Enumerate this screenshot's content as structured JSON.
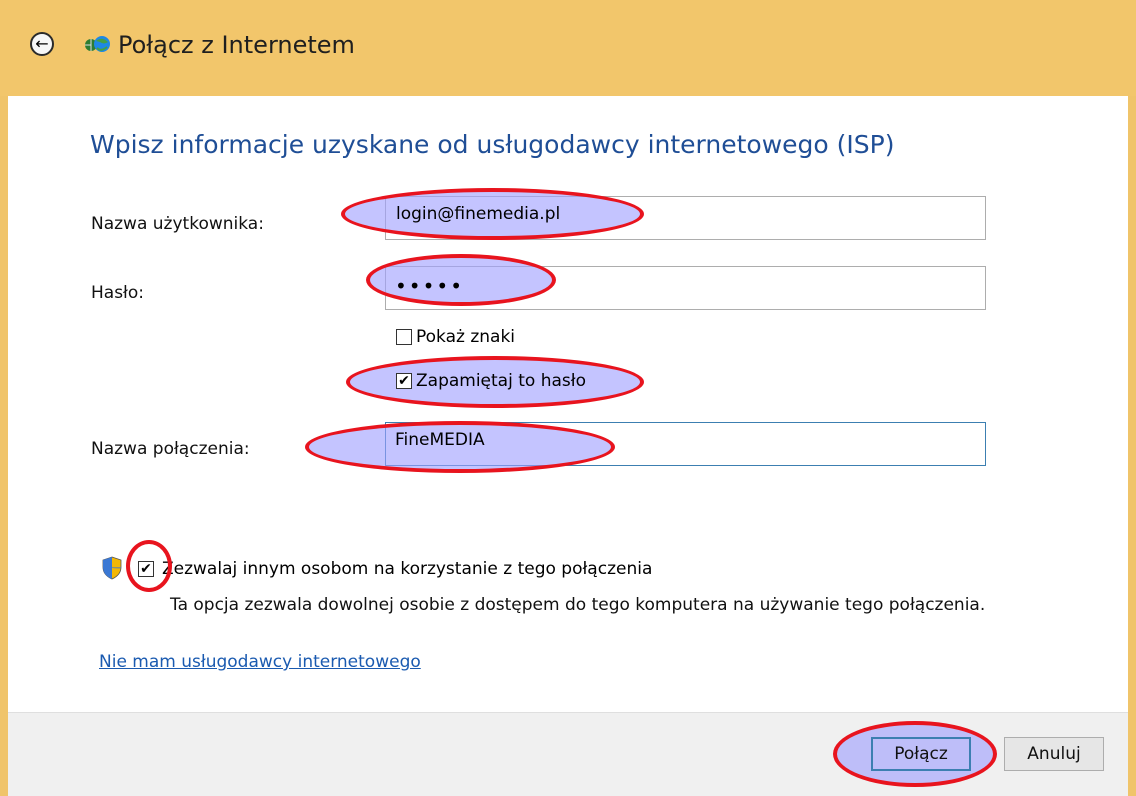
{
  "window": {
    "title": "Połącz z Internetem"
  },
  "main": {
    "heading": "Wpisz informacje uzyskane od usługodawcy internetowego (ISP)",
    "username_label": "Nazwa użytkownika:",
    "username_value": "login@finemedia.pl",
    "password_label": "Hasło:",
    "password_value": "•••••",
    "show_chars_label": "Pokaż znaki",
    "show_chars_checked": false,
    "remember_label": "Zapamiętaj to hasło",
    "remember_checked": true,
    "connection_label": "Nazwa połączenia:",
    "connection_value": "FineMEDIA",
    "allow_others_label": "Zezwalaj innym osobom na korzystanie z tego połączenia",
    "allow_others_checked": true,
    "allow_others_desc": "Ta opcja zezwala dowolnej osobie z dostępem do tego komputera na używanie tego połączenia.",
    "no_isp_link": "Nie mam usługodawcy internetowego"
  },
  "footer": {
    "connect_label": "Połącz",
    "cancel_label": "Anuluj"
  },
  "icons": {
    "back": "back-arrow-icon",
    "title": "network-globe-icon",
    "shield": "uac-shield-icon"
  },
  "colors": {
    "titlebar": "#f2c66b",
    "heading": "#1f4e96",
    "link": "#1a5ab0",
    "annotation_stroke": "#e8141e",
    "annotation_fill": "#a0a0ff"
  }
}
